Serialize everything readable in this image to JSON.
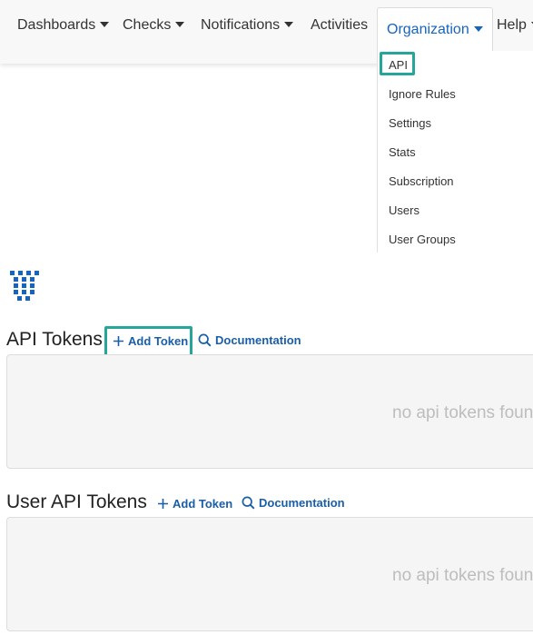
{
  "nav": {
    "items": [
      {
        "label": "Dashboards"
      },
      {
        "label": "Checks"
      },
      {
        "label": "Notifications"
      },
      {
        "label": "Activities"
      },
      {
        "label": "Organization"
      },
      {
        "label": "Help"
      }
    ]
  },
  "dropdown": {
    "items": [
      "API",
      "Ignore Rules",
      "Settings",
      "Stats",
      "Subscription",
      "Users",
      "User Groups"
    ]
  },
  "sections": {
    "api_tokens": {
      "title": "API Tokens",
      "add_label": "Add Token",
      "doc_label": "Documentation",
      "empty": "no api tokens found"
    },
    "user_api_tokens": {
      "title": "User API Tokens",
      "add_label": "Add Token",
      "doc_label": "Documentation",
      "empty": "no api tokens found"
    }
  },
  "colors": {
    "link": "#1a5ea8",
    "active_nav": "#1565c0",
    "highlight": "#26a69a",
    "logo": "#1565c0"
  },
  "icons": {
    "add": "plus-icon",
    "documentation": "magnifier-icon",
    "logo": "logo-icon"
  }
}
